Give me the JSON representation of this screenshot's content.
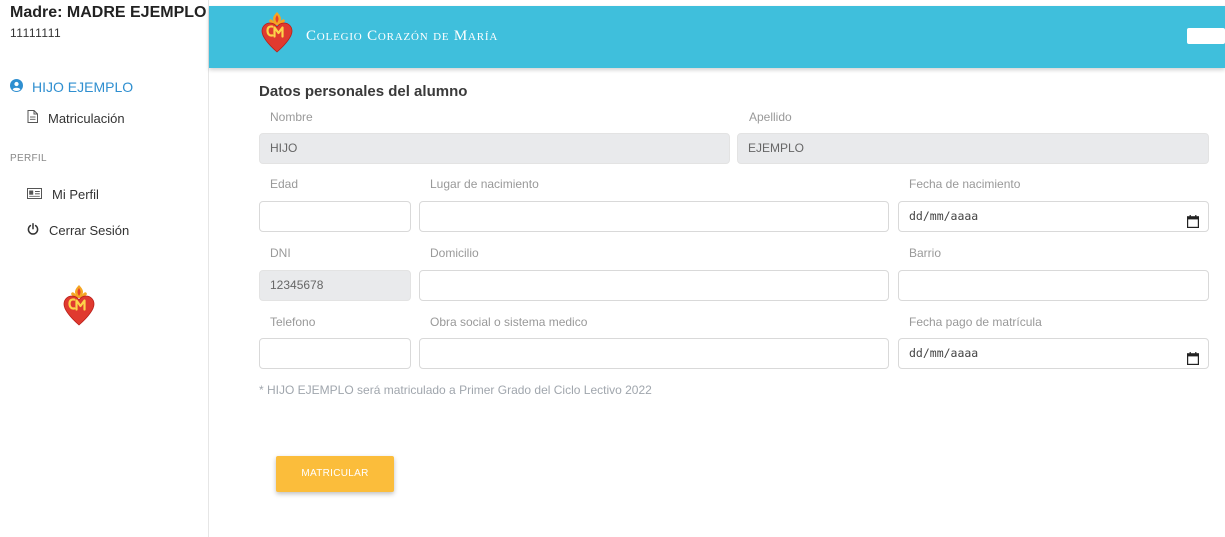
{
  "sidebar": {
    "user_name": "Madre: MADRE EJEMPLO",
    "user_id": "11111111",
    "child": "HIJO EJEMPLO",
    "enrollment": "Matriculación",
    "section_profile": "PERFIL",
    "my_profile": "Mi Perfil",
    "logout": "Cerrar Sesión"
  },
  "header": {
    "school_name": "Colegio Corazón de María",
    "brand_color": "#3fbfdc"
  },
  "form": {
    "title": "Datos personales del alumno",
    "fields": {
      "nombre": {
        "label": "Nombre",
        "value": "HIJO"
      },
      "apellido": {
        "label": "Apellido",
        "value": "EJEMPLO"
      },
      "edad": {
        "label": "Edad",
        "value": ""
      },
      "lugar_nacimiento": {
        "label": "Lugar de nacimiento",
        "value": ""
      },
      "fecha_nacimiento": {
        "label": "Fecha de nacimiento",
        "value": "dd/mm/aaaa"
      },
      "dni": {
        "label": "DNI",
        "value": "12345678"
      },
      "domicilio": {
        "label": "Domicilio",
        "value": ""
      },
      "barrio": {
        "label": "Barrio",
        "value": ""
      },
      "telefono": {
        "label": "Telefono",
        "value": ""
      },
      "obra_social": {
        "label": "Obra social o sistema medico",
        "value": ""
      },
      "fecha_pago": {
        "label": "Fecha pago de matrícula",
        "value": "dd/mm/aaaa"
      }
    },
    "note": "* HIJO EJEMPLO será matriculado a Primer Grado del Ciclo Lectivo 2022",
    "submit_label": "MATRICULAR",
    "button_color": "#fbbd3b"
  },
  "icons": [
    "user-circle-icon",
    "document-icon",
    "id-card-icon",
    "power-icon",
    "calendar-icon",
    "school-heart-logo"
  ]
}
